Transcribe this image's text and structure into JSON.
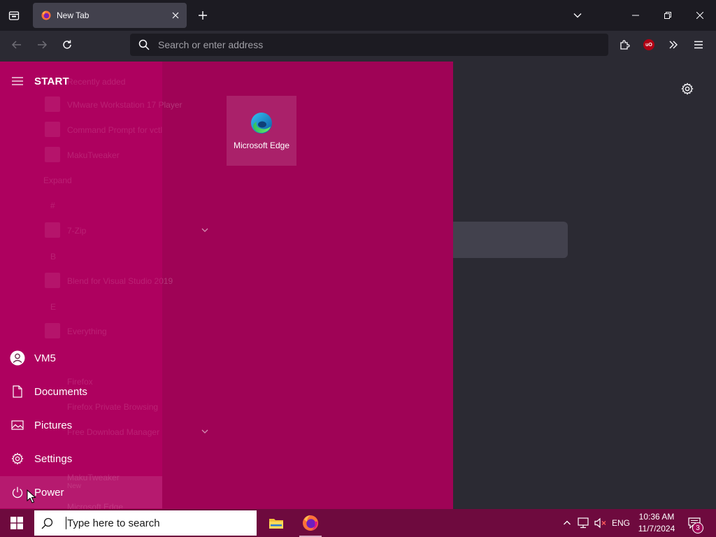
{
  "browser": {
    "tab": {
      "title": "New Tab",
      "favicon": "firefox-icon"
    },
    "urlbar": {
      "placeholder": "Search or enter address"
    },
    "extension_badge": "uO"
  },
  "start_menu": {
    "title": "START",
    "background_color": "#9f0356",
    "rail": [
      {
        "id": "user",
        "label": "VM5",
        "icon": "user-icon"
      },
      {
        "id": "documents",
        "label": "Documents",
        "icon": "document-icon"
      },
      {
        "id": "pictures",
        "label": "Pictures",
        "icon": "pictures-icon"
      },
      {
        "id": "settings",
        "label": "Settings",
        "icon": "gear-icon"
      },
      {
        "id": "power",
        "label": "Power",
        "icon": "power-icon"
      }
    ],
    "app_list": {
      "recently_added_header": "Recently added",
      "items": [
        {
          "label": "VMware Workstation 17 Player",
          "icon": "vmware-icon"
        },
        {
          "label": "Command Prompt for vctl",
          "icon": "cmd-icon"
        },
        {
          "label": "MakuTweaker",
          "icon": "makutweaker-icon"
        }
      ],
      "expand_label": "Expand",
      "group_hash": "#",
      "group_hash_item": "7-Zip",
      "group_b": "B",
      "group_b_item": "Blend for Visual Studio 2019",
      "group_e": "E",
      "group_e_item": "Everything",
      "group_f_items": [
        "Firefox",
        "Firefox Private Browsing",
        "Free Download Manager"
      ],
      "group_m_items": [
        "MakuTweaker",
        "New",
        "Microsoft Edge"
      ]
    },
    "pinned_tile": {
      "label": "Microsoft Edge",
      "icon": "edge-icon"
    }
  },
  "taskbar": {
    "search_placeholder": "Type here to search",
    "apps": [
      {
        "name": "File Explorer",
        "icon": "file-explorer-icon",
        "active": false
      },
      {
        "name": "Firefox",
        "icon": "firefox-icon",
        "active": true
      }
    ],
    "tray": {
      "language": "ENG",
      "time": "10:36 AM",
      "date": "11/7/2024",
      "notifications_count": "3"
    }
  }
}
